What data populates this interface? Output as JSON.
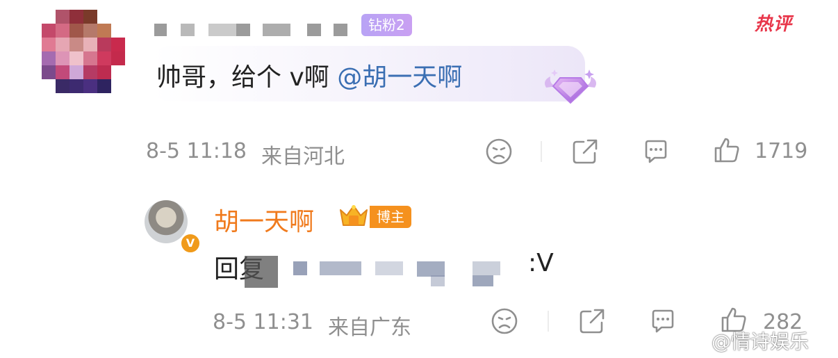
{
  "comment": {
    "fan_badge": "钻粉2",
    "hot_tag": "热评",
    "text_prefix": "帅哥，给个 v啊",
    "mention": "@胡一天啊",
    "timestamp": "8-5 11:18",
    "location": "来自河北",
    "like_count": "1719"
  },
  "reply": {
    "author": "胡一天啊",
    "author_badge": "博主",
    "text_prefix": "回复",
    "text_suffix": ":V",
    "timestamp": "8-5 11:31",
    "location": "来自广东",
    "like_count": "282"
  },
  "watermark": "@情诗娱乐",
  "colors": {
    "mention": "#3b6fb3",
    "author": "#f07a1c",
    "hot_tag": "#e8364a",
    "fan_badge": "#b8a3f5",
    "meta_text": "#8f8f8f"
  }
}
